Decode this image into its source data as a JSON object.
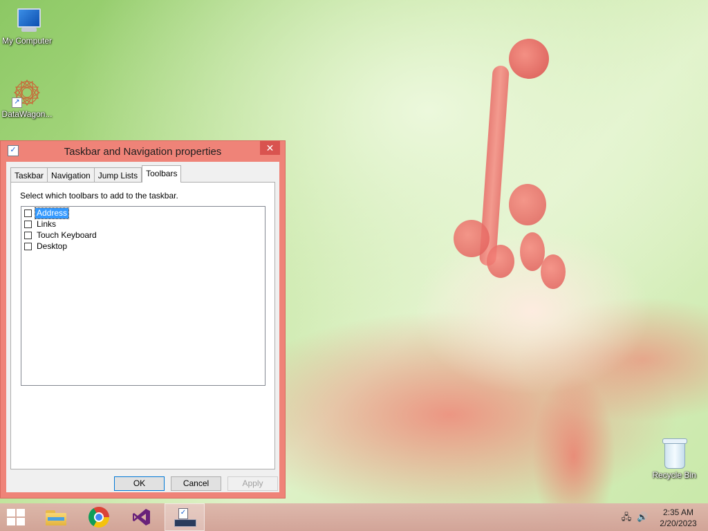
{
  "desktop": {
    "icons": [
      {
        "label": "My Computer",
        "icon": "computer-icon"
      },
      {
        "label": "DataWagon...",
        "icon": "datawagon-shortcut-icon"
      },
      {
        "label": "Recycle Bin",
        "icon": "recycle-bin-icon"
      }
    ]
  },
  "dialog": {
    "title": "Taskbar and Navigation properties",
    "close_glyph": "✕",
    "tabs": [
      {
        "label": "Taskbar",
        "active": false
      },
      {
        "label": "Navigation",
        "active": false
      },
      {
        "label": "Jump Lists",
        "active": false
      },
      {
        "label": "Toolbars",
        "active": true
      }
    ],
    "instruction": "Select which toolbars to add to the taskbar.",
    "toolbars": [
      {
        "label": "Address",
        "checked": false,
        "selected": true
      },
      {
        "label": "Links",
        "checked": false,
        "selected": false
      },
      {
        "label": "Touch Keyboard",
        "checked": false,
        "selected": false
      },
      {
        "label": "Desktop",
        "checked": false,
        "selected": false
      }
    ],
    "buttons": {
      "ok": "OK",
      "cancel": "Cancel",
      "apply": "Apply"
    }
  },
  "taskbar": {
    "pinned": [
      {
        "name": "start-button",
        "icon": "windows-logo-icon"
      },
      {
        "name": "file-explorer",
        "icon": "folder-icon"
      },
      {
        "name": "chrome",
        "icon": "chrome-icon"
      },
      {
        "name": "visual-studio",
        "icon": "visual-studio-icon"
      },
      {
        "name": "control-panel",
        "icon": "control-panel-icon",
        "active": true
      }
    ],
    "clock": {
      "time": "2:35 AM",
      "date": "2/20/2023"
    }
  },
  "colors": {
    "dialog_frame": "#ef8378",
    "close_button": "#d9534f",
    "selection": "#3399ff"
  }
}
